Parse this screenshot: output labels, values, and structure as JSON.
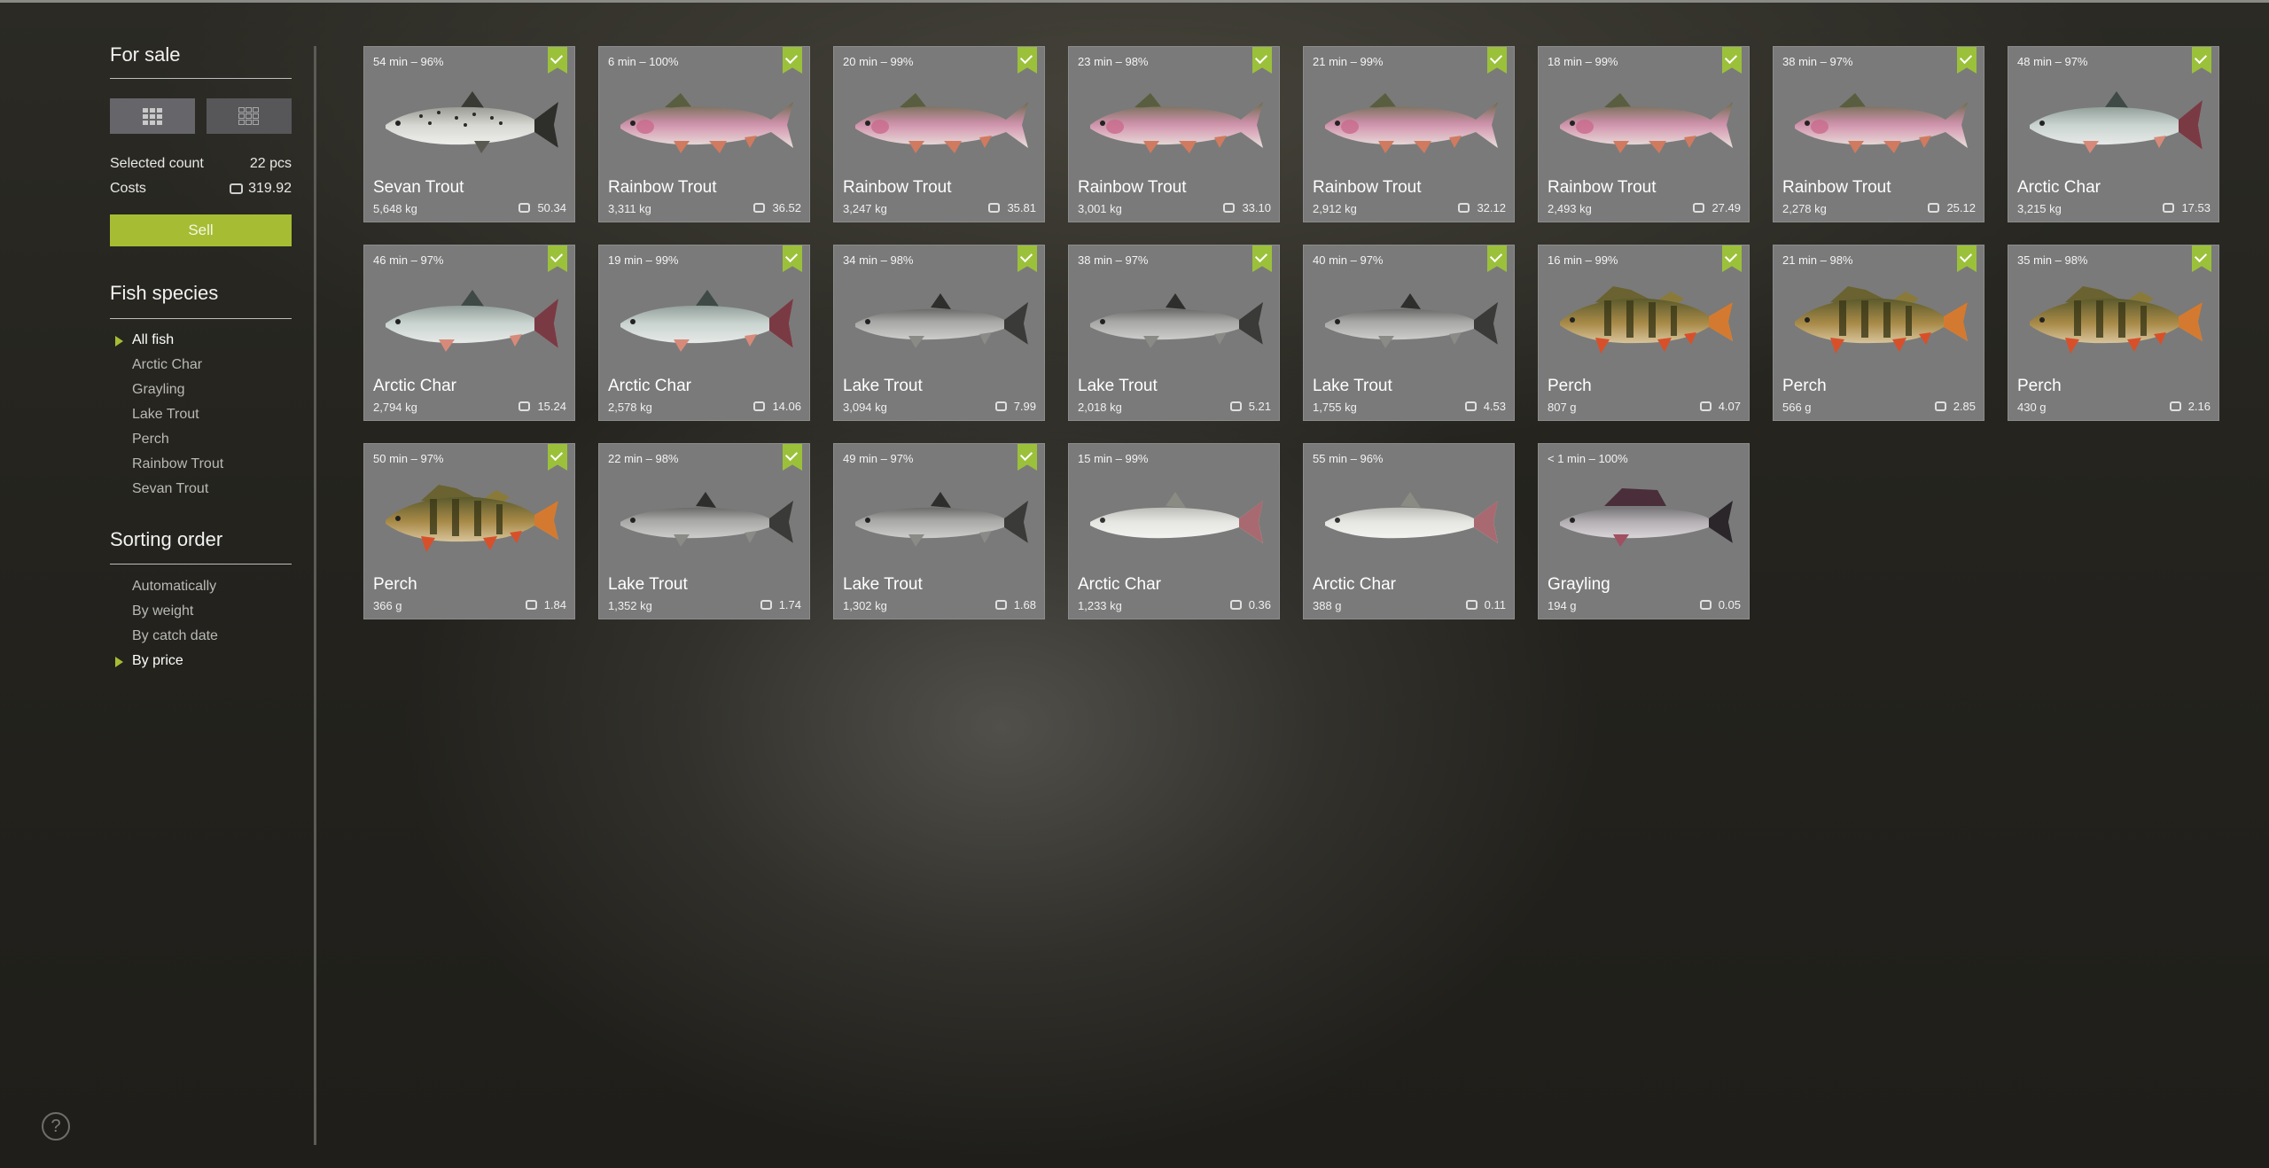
{
  "sidebar": {
    "title": "For sale",
    "selected_label": "Selected count",
    "selected_value": "22 pcs",
    "costs_label": "Costs",
    "costs_value": "319.92",
    "sell_label": "Sell",
    "species_title": "Fish species",
    "species": [
      "All fish",
      "Arctic Char",
      "Grayling",
      "Lake Trout",
      "Perch",
      "Rainbow Trout",
      "Sevan Trout"
    ],
    "sorting_title": "Sorting order",
    "sorting": [
      "Automatically",
      "By weight",
      "By catch date",
      "By price"
    ],
    "help_label": "?"
  },
  "accent_color": "#a6bd33",
  "fish": [
    {
      "time": "54 min – 96%",
      "name": "Sevan Trout",
      "weight": "5,648 kg",
      "price": "50.34",
      "checked": true,
      "kind": "sevan"
    },
    {
      "time": "6 min – 100%",
      "name": "Rainbow Trout",
      "weight": "3,311 kg",
      "price": "36.52",
      "checked": true,
      "kind": "rainbow"
    },
    {
      "time": "20 min – 99%",
      "name": "Rainbow Trout",
      "weight": "3,247 kg",
      "price": "35.81",
      "checked": true,
      "kind": "rainbow"
    },
    {
      "time": "23 min – 98%",
      "name": "Rainbow Trout",
      "weight": "3,001 kg",
      "price": "33.10",
      "checked": true,
      "kind": "rainbow"
    },
    {
      "time": "21 min – 99%",
      "name": "Rainbow Trout",
      "weight": "2,912 kg",
      "price": "32.12",
      "checked": true,
      "kind": "rainbow"
    },
    {
      "time": "18 min – 99%",
      "name": "Rainbow Trout",
      "weight": "2,493 kg",
      "price": "27.49",
      "checked": true,
      "kind": "rainbow"
    },
    {
      "time": "38 min – 97%",
      "name": "Rainbow Trout",
      "weight": "2,278 kg",
      "price": "25.12",
      "checked": true,
      "kind": "rainbow"
    },
    {
      "time": "48 min – 97%",
      "name": "Arctic Char",
      "weight": "3,215 kg",
      "price": "17.53",
      "checked": true,
      "kind": "char"
    },
    {
      "time": "46 min – 97%",
      "name": "Arctic Char",
      "weight": "2,794 kg",
      "price": "15.24",
      "checked": true,
      "kind": "char"
    },
    {
      "time": "19 min – 99%",
      "name": "Arctic Char",
      "weight": "2,578 kg",
      "price": "14.06",
      "checked": true,
      "kind": "char"
    },
    {
      "time": "34 min – 98%",
      "name": "Lake Trout",
      "weight": "3,094 kg",
      "price": "7.99",
      "checked": true,
      "kind": "lake"
    },
    {
      "time": "38 min – 97%",
      "name": "Lake Trout",
      "weight": "2,018 kg",
      "price": "5.21",
      "checked": true,
      "kind": "lake"
    },
    {
      "time": "40 min – 97%",
      "name": "Lake Trout",
      "weight": "1,755 kg",
      "price": "4.53",
      "checked": true,
      "kind": "lake"
    },
    {
      "time": "16 min – 99%",
      "name": "Perch",
      "weight": "807 g",
      "price": "4.07",
      "checked": true,
      "kind": "perch"
    },
    {
      "time": "21 min – 98%",
      "name": "Perch",
      "weight": "566 g",
      "price": "2.85",
      "checked": true,
      "kind": "perch"
    },
    {
      "time": "35 min – 98%",
      "name": "Perch",
      "weight": "430 g",
      "price": "2.16",
      "checked": true,
      "kind": "perch"
    },
    {
      "time": "50 min – 97%",
      "name": "Perch",
      "weight": "366 g",
      "price": "1.84",
      "checked": true,
      "kind": "perch"
    },
    {
      "time": "22 min – 98%",
      "name": "Lake Trout",
      "weight": "1,352 kg",
      "price": "1.74",
      "checked": true,
      "kind": "lake"
    },
    {
      "time": "49 min – 97%",
      "name": "Lake Trout",
      "weight": "1,302 kg",
      "price": "1.68",
      "checked": true,
      "kind": "lake"
    },
    {
      "time": "15 min – 99%",
      "name": "Arctic Char",
      "weight": "1,233 kg",
      "price": "0.36",
      "checked": false,
      "kind": "char-pale"
    },
    {
      "time": "55 min – 96%",
      "name": "Arctic Char",
      "weight": "388 g",
      "price": "0.11",
      "checked": false,
      "kind": "char-pale"
    },
    {
      "time": "< 1 min – 100%",
      "name": "Grayling",
      "weight": "194 g",
      "price": "0.05",
      "checked": false,
      "kind": "grayling"
    }
  ]
}
